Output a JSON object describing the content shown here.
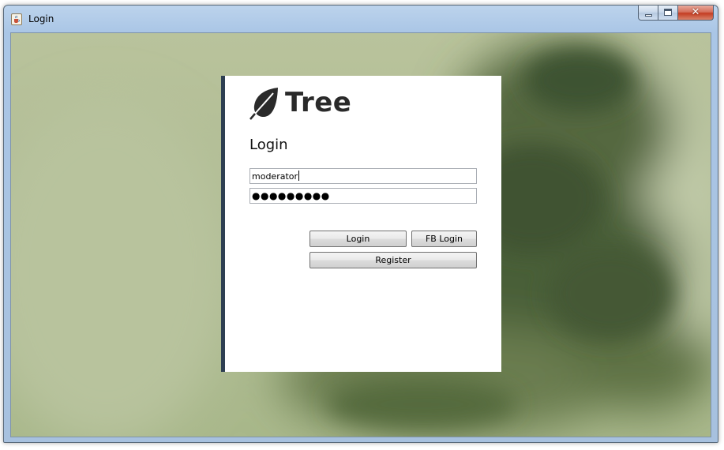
{
  "window": {
    "title": "Login",
    "app_icon": "java-cup-icon",
    "close_glyph": "✕"
  },
  "card": {
    "brand_name": "Tree",
    "logo_icon": "leaf-icon",
    "heading": "Login",
    "username_value": "moderator",
    "password_mask": "●●●●●●●●●",
    "login_label": "Login",
    "fb_login_label": "FB Login",
    "register_label": "Register"
  },
  "colors": {
    "card_accent": "#2e3f52",
    "background_tint": "#aab892",
    "tree_foliage": "#3e5230"
  }
}
